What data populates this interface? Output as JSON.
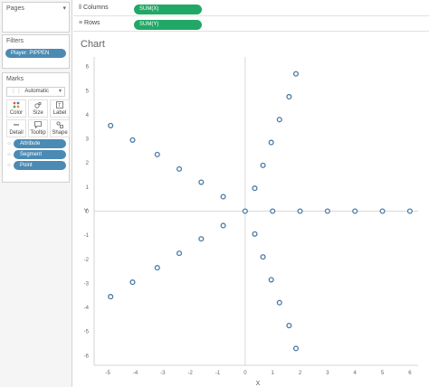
{
  "sidebar": {
    "pages": {
      "title": "Pages"
    },
    "filters": {
      "title": "Filters",
      "pill": "Player: PIPPEN"
    },
    "marks": {
      "title": "Marks",
      "type": "Automatic",
      "buttons": [
        {
          "label": "Color",
          "icon": "color-dots-icon"
        },
        {
          "label": "Size",
          "icon": "size-icon"
        },
        {
          "label": "Label",
          "icon": "label-icon"
        },
        {
          "label": "Detail",
          "icon": "detail-icon"
        },
        {
          "label": "Tooltip",
          "icon": "tooltip-icon"
        },
        {
          "label": "Shape",
          "icon": "shape-icon"
        }
      ],
      "fields": [
        "Attribute",
        "Segment",
        "Point"
      ]
    }
  },
  "shelves": {
    "columns": {
      "label": "Columns",
      "pill": "SUM(X)"
    },
    "rows": {
      "label": "Rows",
      "pill": "SUM(Y)"
    }
  },
  "colors": {
    "dimension_pill": "#4b8ab3",
    "measure_pill": "#22a866",
    "mark": "#4a79a5"
  },
  "chart_data": {
    "type": "scatter",
    "title": "Chart",
    "xlabel": "X",
    "ylabel": "Y",
    "xlim": [
      -5.5,
      6.3
    ],
    "ylim": [
      -6.4,
      6.4
    ],
    "xticks": [
      -5,
      -4,
      -3,
      -2,
      -1,
      0,
      1,
      2,
      3,
      4,
      5,
      6
    ],
    "yticks": [
      6,
      5,
      4,
      3,
      2,
      1,
      0,
      -1,
      -2,
      -3,
      -4,
      -5,
      -6
    ],
    "grid": false,
    "marker": "hollow-circle",
    "series": [
      {
        "points": [
          [
            -4.9,
            3.55
          ],
          [
            -4.1,
            2.95
          ],
          [
            -3.2,
            2.35
          ],
          [
            -2.4,
            1.75
          ],
          [
            -1.6,
            1.2
          ],
          [
            -0.8,
            0.6
          ],
          [
            0,
            0
          ],
          [
            1,
            0
          ],
          [
            2,
            0
          ],
          [
            3,
            0
          ],
          [
            4,
            0
          ],
          [
            5,
            0
          ],
          [
            6,
            0
          ],
          [
            0.35,
            0.95
          ],
          [
            0.65,
            1.9
          ],
          [
            0.95,
            2.85
          ],
          [
            1.25,
            3.8
          ],
          [
            1.6,
            4.75
          ],
          [
            1.85,
            5.7
          ],
          [
            -0.8,
            -0.6
          ],
          [
            -1.6,
            -1.15
          ],
          [
            -2.4,
            -1.75
          ],
          [
            -3.2,
            -2.35
          ],
          [
            -4.1,
            -2.95
          ],
          [
            -4.9,
            -3.55
          ],
          [
            0.35,
            -0.95
          ],
          [
            0.65,
            -1.9
          ],
          [
            0.95,
            -2.85
          ],
          [
            1.25,
            -3.8
          ],
          [
            1.6,
            -4.75
          ],
          [
            1.85,
            -5.7
          ]
        ]
      }
    ]
  }
}
